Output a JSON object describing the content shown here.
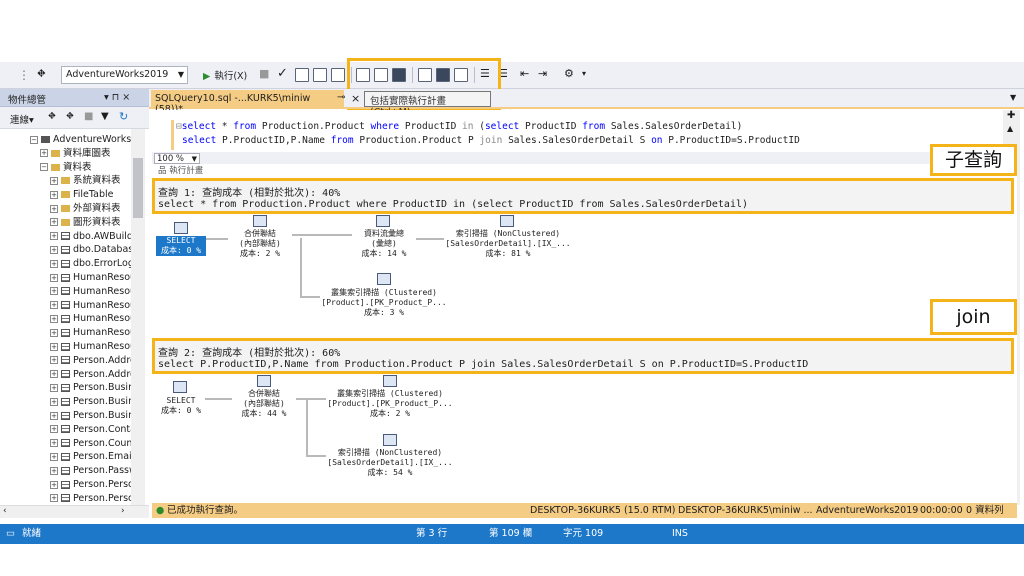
{
  "toolbar": {
    "database": "AdventureWorks2019",
    "execute_label": "執行(X)"
  },
  "tooltip": "包括實際執行計畫 (Ctrl+M)",
  "object_explorer": {
    "title": "物件總管",
    "pin": "▾ ⊓ ×",
    "connect_label": "連線▾",
    "tree": [
      {
        "label": "AdventureWorks2",
        "type": "db",
        "expanded": true
      },
      {
        "label": "資料庫圖表",
        "type": "folder"
      },
      {
        "label": "資料表",
        "type": "folder",
        "expanded": true
      },
      {
        "label": "系統資料表",
        "type": "folder"
      },
      {
        "label": "FileTable",
        "type": "folder"
      },
      {
        "label": "外部資料表",
        "type": "folder"
      },
      {
        "label": "圖形資料表",
        "type": "folder"
      },
      {
        "label": "dbo.AWBuildV",
        "type": "table"
      },
      {
        "label": "dbo.Database",
        "type": "table"
      },
      {
        "label": "dbo.ErrorLog",
        "type": "table"
      },
      {
        "label": "HumanResou",
        "type": "table"
      },
      {
        "label": "HumanResou",
        "type": "table"
      },
      {
        "label": "HumanResou",
        "type": "table"
      },
      {
        "label": "HumanResou",
        "type": "table"
      },
      {
        "label": "HumanResou",
        "type": "table"
      },
      {
        "label": "HumanResou",
        "type": "table"
      },
      {
        "label": "Person.Addre",
        "type": "table"
      },
      {
        "label": "Person.Addre",
        "type": "table"
      },
      {
        "label": "Person.Busine",
        "type": "table"
      },
      {
        "label": "Person.Busine",
        "type": "table"
      },
      {
        "label": "Person.Busine",
        "type": "table"
      },
      {
        "label": "Person.Conta",
        "type": "table"
      },
      {
        "label": "Person.Count",
        "type": "table"
      },
      {
        "label": "Person.Email",
        "type": "table"
      },
      {
        "label": "Person.Passw",
        "type": "table"
      },
      {
        "label": "Person.Persor",
        "type": "table"
      },
      {
        "label": "Person.Persor",
        "type": "table"
      }
    ]
  },
  "tab": {
    "title": "SQLQuery10.sql -...KURK5\\miniw (58))*",
    "pin": "⊸",
    "close": "×"
  },
  "editor": {
    "line1": {
      "k1": "select",
      "s1": " * ",
      "k2": "from",
      "s2": " Production.Product ",
      "k3": "where",
      "s3": " ProductID ",
      "k4": "in",
      "s4": " (",
      "k5": "select",
      "s5": " ProductID ",
      "k6": "from",
      "s6": " Sales.SalesOrderDetail)"
    },
    "line2": {
      "k1": "select",
      "s1": " P.ProductID,P.Name ",
      "k2": "from",
      "s2": " Production.Product P ",
      "k3": "join",
      "s3": " Sales.SalesOrderDetail S ",
      "k4": "on",
      "s4": " P.ProductID=S.ProductID"
    }
  },
  "zoom": "100 %",
  "plan_tab": "品 執行計畫",
  "query1": {
    "header": "查詢 1: 查詢成本 (相對於批次): 40%",
    "sql": "select * from Production.Product where ProductID in (select ProductID from Sales.SalesOrderDetail)",
    "ops": {
      "select": {
        "name": "SELECT",
        "cost": "成本: 0 %"
      },
      "merge": {
        "name": "合併聯結",
        "sub": "(內部聯結)",
        "cost": "成本: 2 %"
      },
      "stream": {
        "name": "資料流彙總",
        "sub": "(彙總)",
        "cost": "成本: 14 %"
      },
      "idxscan": {
        "name": "索引掃描 (NonClustered)",
        "sub": "[SalesOrderDetail].[IX_...",
        "cost": "成本: 81 %"
      },
      "clustered": {
        "name": "叢集索引掃描 (Clustered)",
        "sub": "[Product].[PK_Product_P...",
        "cost": "成本: 3 %"
      }
    }
  },
  "query2": {
    "header": "查詢 2: 查詢成本 (相對於批次): 60%",
    "sql": "select P.ProductID,P.Name from Production.Product P join Sales.SalesOrderDetail S on P.ProductID=S.ProductID",
    "ops": {
      "select": {
        "name": "SELECT",
        "cost": "成本: 0 %"
      },
      "merge": {
        "name": "合併聯結",
        "sub": "(內部聯結)",
        "cost": "成本: 44 %"
      },
      "clustered": {
        "name": "叢集索引掃描 (Clustered)",
        "sub": "[Product].[PK_Product_P...",
        "cost": "成本: 2 %"
      },
      "idxscan": {
        "name": "索引掃描 (NonClustered)",
        "sub": "[SalesOrderDetail].[IX_...",
        "cost": "成本: 54 %"
      }
    }
  },
  "callouts": {
    "subquery": "子查詢",
    "join": "join"
  },
  "status": {
    "message": "已成功執行查詢。",
    "server": "DESKTOP-36KURK5 (15.0 RTM)",
    "user": "DESKTOP-36KURK5\\miniw ...",
    "db": "AdventureWorks2019",
    "time": "00:00:00",
    "rows": "0 資料列"
  },
  "bottombar": {
    "ready": "就緒",
    "line": "第 3 行",
    "col": "第 109 欄",
    "ch": "字元 109",
    "mode": "INS"
  },
  "colors": {
    "accent": "#f5b31a",
    "tab": "#f5cc84",
    "statusbar": "#1d78c9",
    "keyword": "#0000ff"
  }
}
